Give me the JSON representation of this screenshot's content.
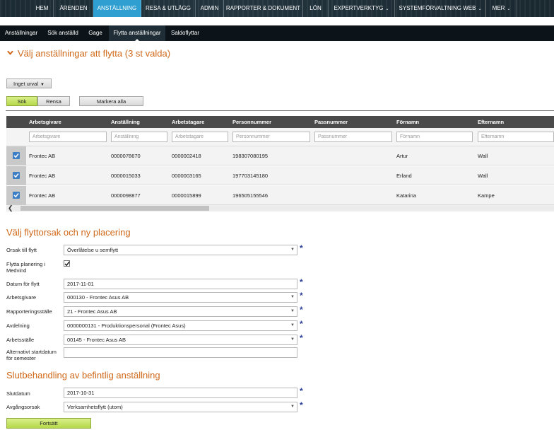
{
  "topnav": {
    "items": [
      {
        "label": "HEM"
      },
      {
        "label": "ÄRENDEN"
      },
      {
        "label": "ANSTÄLLNING"
      },
      {
        "label": "RESA & UTLÄGG"
      },
      {
        "label": "ADMIN"
      },
      {
        "label": "RAPPORTER & DOKUMENT"
      },
      {
        "label": "LÖN"
      },
      {
        "label": "EXPERTVERKTYG"
      },
      {
        "label": "SYSTEMFÖRVALTNING WEB"
      },
      {
        "label": "MER"
      }
    ],
    "active_index": 2,
    "caret_glyph": "⌄",
    "colors": {
      "background": "#1a2a33",
      "active": "#2e9fd0"
    }
  },
  "subnav": {
    "items": [
      {
        "label": "Anställningar"
      },
      {
        "label": "Sök anställd"
      },
      {
        "label": "Gage"
      },
      {
        "label": "Flytta anställningar"
      },
      {
        "label": "Saldoflyttar"
      }
    ],
    "active_index": 3
  },
  "page": {
    "title": "Välj anställningar att flytta (3 st valda)",
    "accent_color": "#d0681a"
  },
  "controls": {
    "selection_label": "Inget urval",
    "search_label": "Sök",
    "clear_label": "Rensa",
    "mark_all_label": "Markera alla"
  },
  "table": {
    "columns": [
      "Arbetsgivare",
      "Anställning",
      "Arbetstagare",
      "Personnummer",
      "Passnummer",
      "Förnamn",
      "Efternamn"
    ],
    "filter_placeholders": [
      "Arbetsgivare",
      "Anställning",
      "Arbetstagare",
      "Personnummer",
      "Passnummer",
      "Förnamn",
      "Efternamn"
    ],
    "rows": [
      {
        "checked": true,
        "cells": [
          "Frontec AB",
          "0000078670",
          "0000002418",
          "198307080195",
          "",
          "Artur",
          "Wall"
        ]
      },
      {
        "checked": true,
        "cells": [
          "Frontec AB",
          "0000015033",
          "0000003165",
          "197703145180",
          "",
          "Erland",
          "Wall"
        ]
      },
      {
        "checked": true,
        "cells": [
          "Frontec AB",
          "0000098877",
          "0000015899",
          "196505155546",
          "",
          "Katarina",
          "Kampe"
        ]
      }
    ]
  },
  "move_section": {
    "title": "Välj flyttorsak och ny placering",
    "fields": {
      "reason": {
        "label": "Orsak till flytt",
        "value": "Överlåtelse u semflytt"
      },
      "move_planning": {
        "label": "Flytta planering i Medvind",
        "checked": true
      },
      "move_date": {
        "label": "Datum för flytt",
        "value": "2017-11-01"
      },
      "employer": {
        "label": "Arbetsgivare",
        "value": "000130 - Frontec Asus AB"
      },
      "reporting_place": {
        "label": "Rapporteringsställe",
        "value": "21 - Frontec Asus AB"
      },
      "department": {
        "label": "Avdelning",
        "value": "0000000131 - Produktionspersonal (Frontec Asus)"
      },
      "workplace": {
        "label": "Arbetsställe",
        "value": "00145 - Frontec Asus AB"
      },
      "alt_start": {
        "label": "Alternativt startdatum för semester",
        "value": ""
      }
    }
  },
  "end_section": {
    "title": "Slutbehandling av befintlig anställning",
    "fields": {
      "end_date": {
        "label": "Slutdatum",
        "value": "2017-10-31"
      },
      "leave_reason": {
        "label": "Avgångsorsak",
        "value": "Verksamhetsflytt (utom)"
      }
    },
    "continue_label": "Fortsätt"
  },
  "required_marker": "*",
  "dropdown_glyph": "▼",
  "caret_down": "▾",
  "scroll_left_glyph": "❮"
}
